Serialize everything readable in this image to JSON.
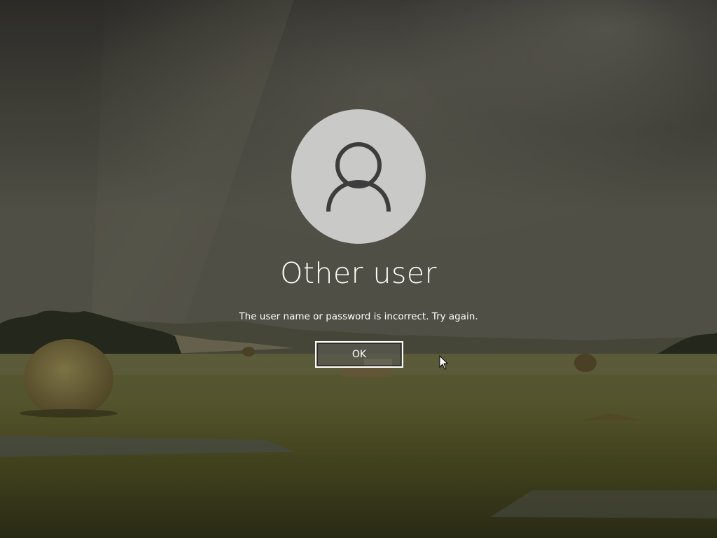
{
  "login": {
    "user_name": "Other user",
    "message": "The user name or password is incorrect. Try again.",
    "ok_label": "OK"
  },
  "icons": {
    "avatar": "user-silhouette-icon",
    "cursor": "mouse-pointer-icon"
  },
  "colors": {
    "avatar_bg": "#c9c9c7",
    "avatar_glyph": "#3d3d3d",
    "text": "#ffffff",
    "button_border": "#ffffff"
  }
}
